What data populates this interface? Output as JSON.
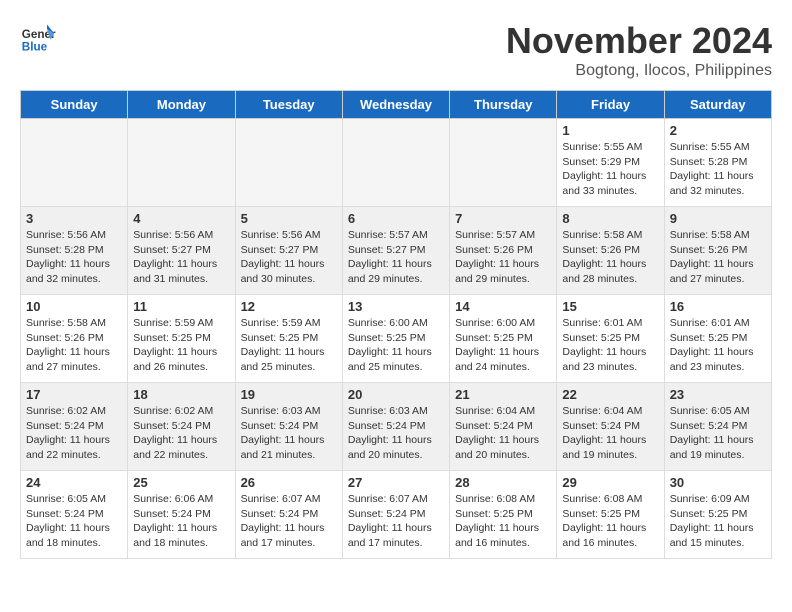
{
  "header": {
    "logo_text_general": "General",
    "logo_text_blue": "Blue",
    "month_title": "November 2024",
    "subtitle": "Bogtong, Ilocos, Philippines"
  },
  "weekdays": [
    "Sunday",
    "Monday",
    "Tuesday",
    "Wednesday",
    "Thursday",
    "Friday",
    "Saturday"
  ],
  "weeks": [
    [
      {
        "day": "",
        "info": ""
      },
      {
        "day": "",
        "info": ""
      },
      {
        "day": "",
        "info": ""
      },
      {
        "day": "",
        "info": ""
      },
      {
        "day": "",
        "info": ""
      },
      {
        "day": "1",
        "info": "Sunrise: 5:55 AM\nSunset: 5:29 PM\nDaylight: 11 hours\nand 33 minutes."
      },
      {
        "day": "2",
        "info": "Sunrise: 5:55 AM\nSunset: 5:28 PM\nDaylight: 11 hours\nand 32 minutes."
      }
    ],
    [
      {
        "day": "3",
        "info": "Sunrise: 5:56 AM\nSunset: 5:28 PM\nDaylight: 11 hours\nand 32 minutes."
      },
      {
        "day": "4",
        "info": "Sunrise: 5:56 AM\nSunset: 5:27 PM\nDaylight: 11 hours\nand 31 minutes."
      },
      {
        "day": "5",
        "info": "Sunrise: 5:56 AM\nSunset: 5:27 PM\nDaylight: 11 hours\nand 30 minutes."
      },
      {
        "day": "6",
        "info": "Sunrise: 5:57 AM\nSunset: 5:27 PM\nDaylight: 11 hours\nand 29 minutes."
      },
      {
        "day": "7",
        "info": "Sunrise: 5:57 AM\nSunset: 5:26 PM\nDaylight: 11 hours\nand 29 minutes."
      },
      {
        "day": "8",
        "info": "Sunrise: 5:58 AM\nSunset: 5:26 PM\nDaylight: 11 hours\nand 28 minutes."
      },
      {
        "day": "9",
        "info": "Sunrise: 5:58 AM\nSunset: 5:26 PM\nDaylight: 11 hours\nand 27 minutes."
      }
    ],
    [
      {
        "day": "10",
        "info": "Sunrise: 5:58 AM\nSunset: 5:26 PM\nDaylight: 11 hours\nand 27 minutes."
      },
      {
        "day": "11",
        "info": "Sunrise: 5:59 AM\nSunset: 5:25 PM\nDaylight: 11 hours\nand 26 minutes."
      },
      {
        "day": "12",
        "info": "Sunrise: 5:59 AM\nSunset: 5:25 PM\nDaylight: 11 hours\nand 25 minutes."
      },
      {
        "day": "13",
        "info": "Sunrise: 6:00 AM\nSunset: 5:25 PM\nDaylight: 11 hours\nand 25 minutes."
      },
      {
        "day": "14",
        "info": "Sunrise: 6:00 AM\nSunset: 5:25 PM\nDaylight: 11 hours\nand 24 minutes."
      },
      {
        "day": "15",
        "info": "Sunrise: 6:01 AM\nSunset: 5:25 PM\nDaylight: 11 hours\nand 23 minutes."
      },
      {
        "day": "16",
        "info": "Sunrise: 6:01 AM\nSunset: 5:25 PM\nDaylight: 11 hours\nand 23 minutes."
      }
    ],
    [
      {
        "day": "17",
        "info": "Sunrise: 6:02 AM\nSunset: 5:24 PM\nDaylight: 11 hours\nand 22 minutes."
      },
      {
        "day": "18",
        "info": "Sunrise: 6:02 AM\nSunset: 5:24 PM\nDaylight: 11 hours\nand 22 minutes."
      },
      {
        "day": "19",
        "info": "Sunrise: 6:03 AM\nSunset: 5:24 PM\nDaylight: 11 hours\nand 21 minutes."
      },
      {
        "day": "20",
        "info": "Sunrise: 6:03 AM\nSunset: 5:24 PM\nDaylight: 11 hours\nand 20 minutes."
      },
      {
        "day": "21",
        "info": "Sunrise: 6:04 AM\nSunset: 5:24 PM\nDaylight: 11 hours\nand 20 minutes."
      },
      {
        "day": "22",
        "info": "Sunrise: 6:04 AM\nSunset: 5:24 PM\nDaylight: 11 hours\nand 19 minutes."
      },
      {
        "day": "23",
        "info": "Sunrise: 6:05 AM\nSunset: 5:24 PM\nDaylight: 11 hours\nand 19 minutes."
      }
    ],
    [
      {
        "day": "24",
        "info": "Sunrise: 6:05 AM\nSunset: 5:24 PM\nDaylight: 11 hours\nand 18 minutes."
      },
      {
        "day": "25",
        "info": "Sunrise: 6:06 AM\nSunset: 5:24 PM\nDaylight: 11 hours\nand 18 minutes."
      },
      {
        "day": "26",
        "info": "Sunrise: 6:07 AM\nSunset: 5:24 PM\nDaylight: 11 hours\nand 17 minutes."
      },
      {
        "day": "27",
        "info": "Sunrise: 6:07 AM\nSunset: 5:24 PM\nDaylight: 11 hours\nand 17 minutes."
      },
      {
        "day": "28",
        "info": "Sunrise: 6:08 AM\nSunset: 5:25 PM\nDaylight: 11 hours\nand 16 minutes."
      },
      {
        "day": "29",
        "info": "Sunrise: 6:08 AM\nSunset: 5:25 PM\nDaylight: 11 hours\nand 16 minutes."
      },
      {
        "day": "30",
        "info": "Sunrise: 6:09 AM\nSunset: 5:25 PM\nDaylight: 11 hours\nand 15 minutes."
      }
    ]
  ]
}
